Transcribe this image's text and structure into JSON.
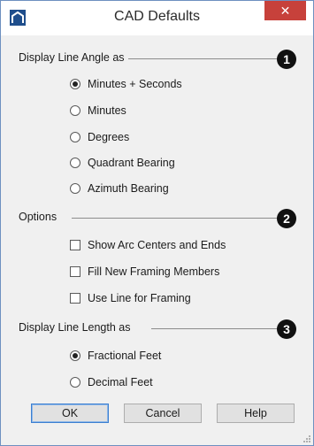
{
  "window": {
    "title": "CAD Defaults",
    "close_glyph": "✕",
    "app_icon": "chief-architect-icon",
    "close_color": "#c7413b"
  },
  "sections": {
    "angle": {
      "label": "Display Line Angle as",
      "badge": "1",
      "options": [
        {
          "label": "Minutes + Seconds",
          "checked": true
        },
        {
          "label": "Minutes",
          "checked": false
        },
        {
          "label": "Degrees",
          "checked": false
        },
        {
          "label": "Quadrant Bearing",
          "checked": false
        },
        {
          "label": "Azimuth Bearing",
          "checked": false
        }
      ]
    },
    "options": {
      "label": "Options",
      "badge": "2",
      "items": [
        {
          "label": "Show Arc Centers and Ends",
          "checked": false
        },
        {
          "label": "Fill New Framing Members",
          "checked": false
        },
        {
          "label": "Use Line for Framing",
          "checked": false
        }
      ]
    },
    "length": {
      "label": "Display Line Length as",
      "badge": "3",
      "options": [
        {
          "label": "Fractional Feet",
          "checked": true
        },
        {
          "label": "Decimal Feet",
          "checked": false
        }
      ]
    }
  },
  "buttons": {
    "ok": "OK",
    "cancel": "Cancel",
    "help": "Help"
  }
}
